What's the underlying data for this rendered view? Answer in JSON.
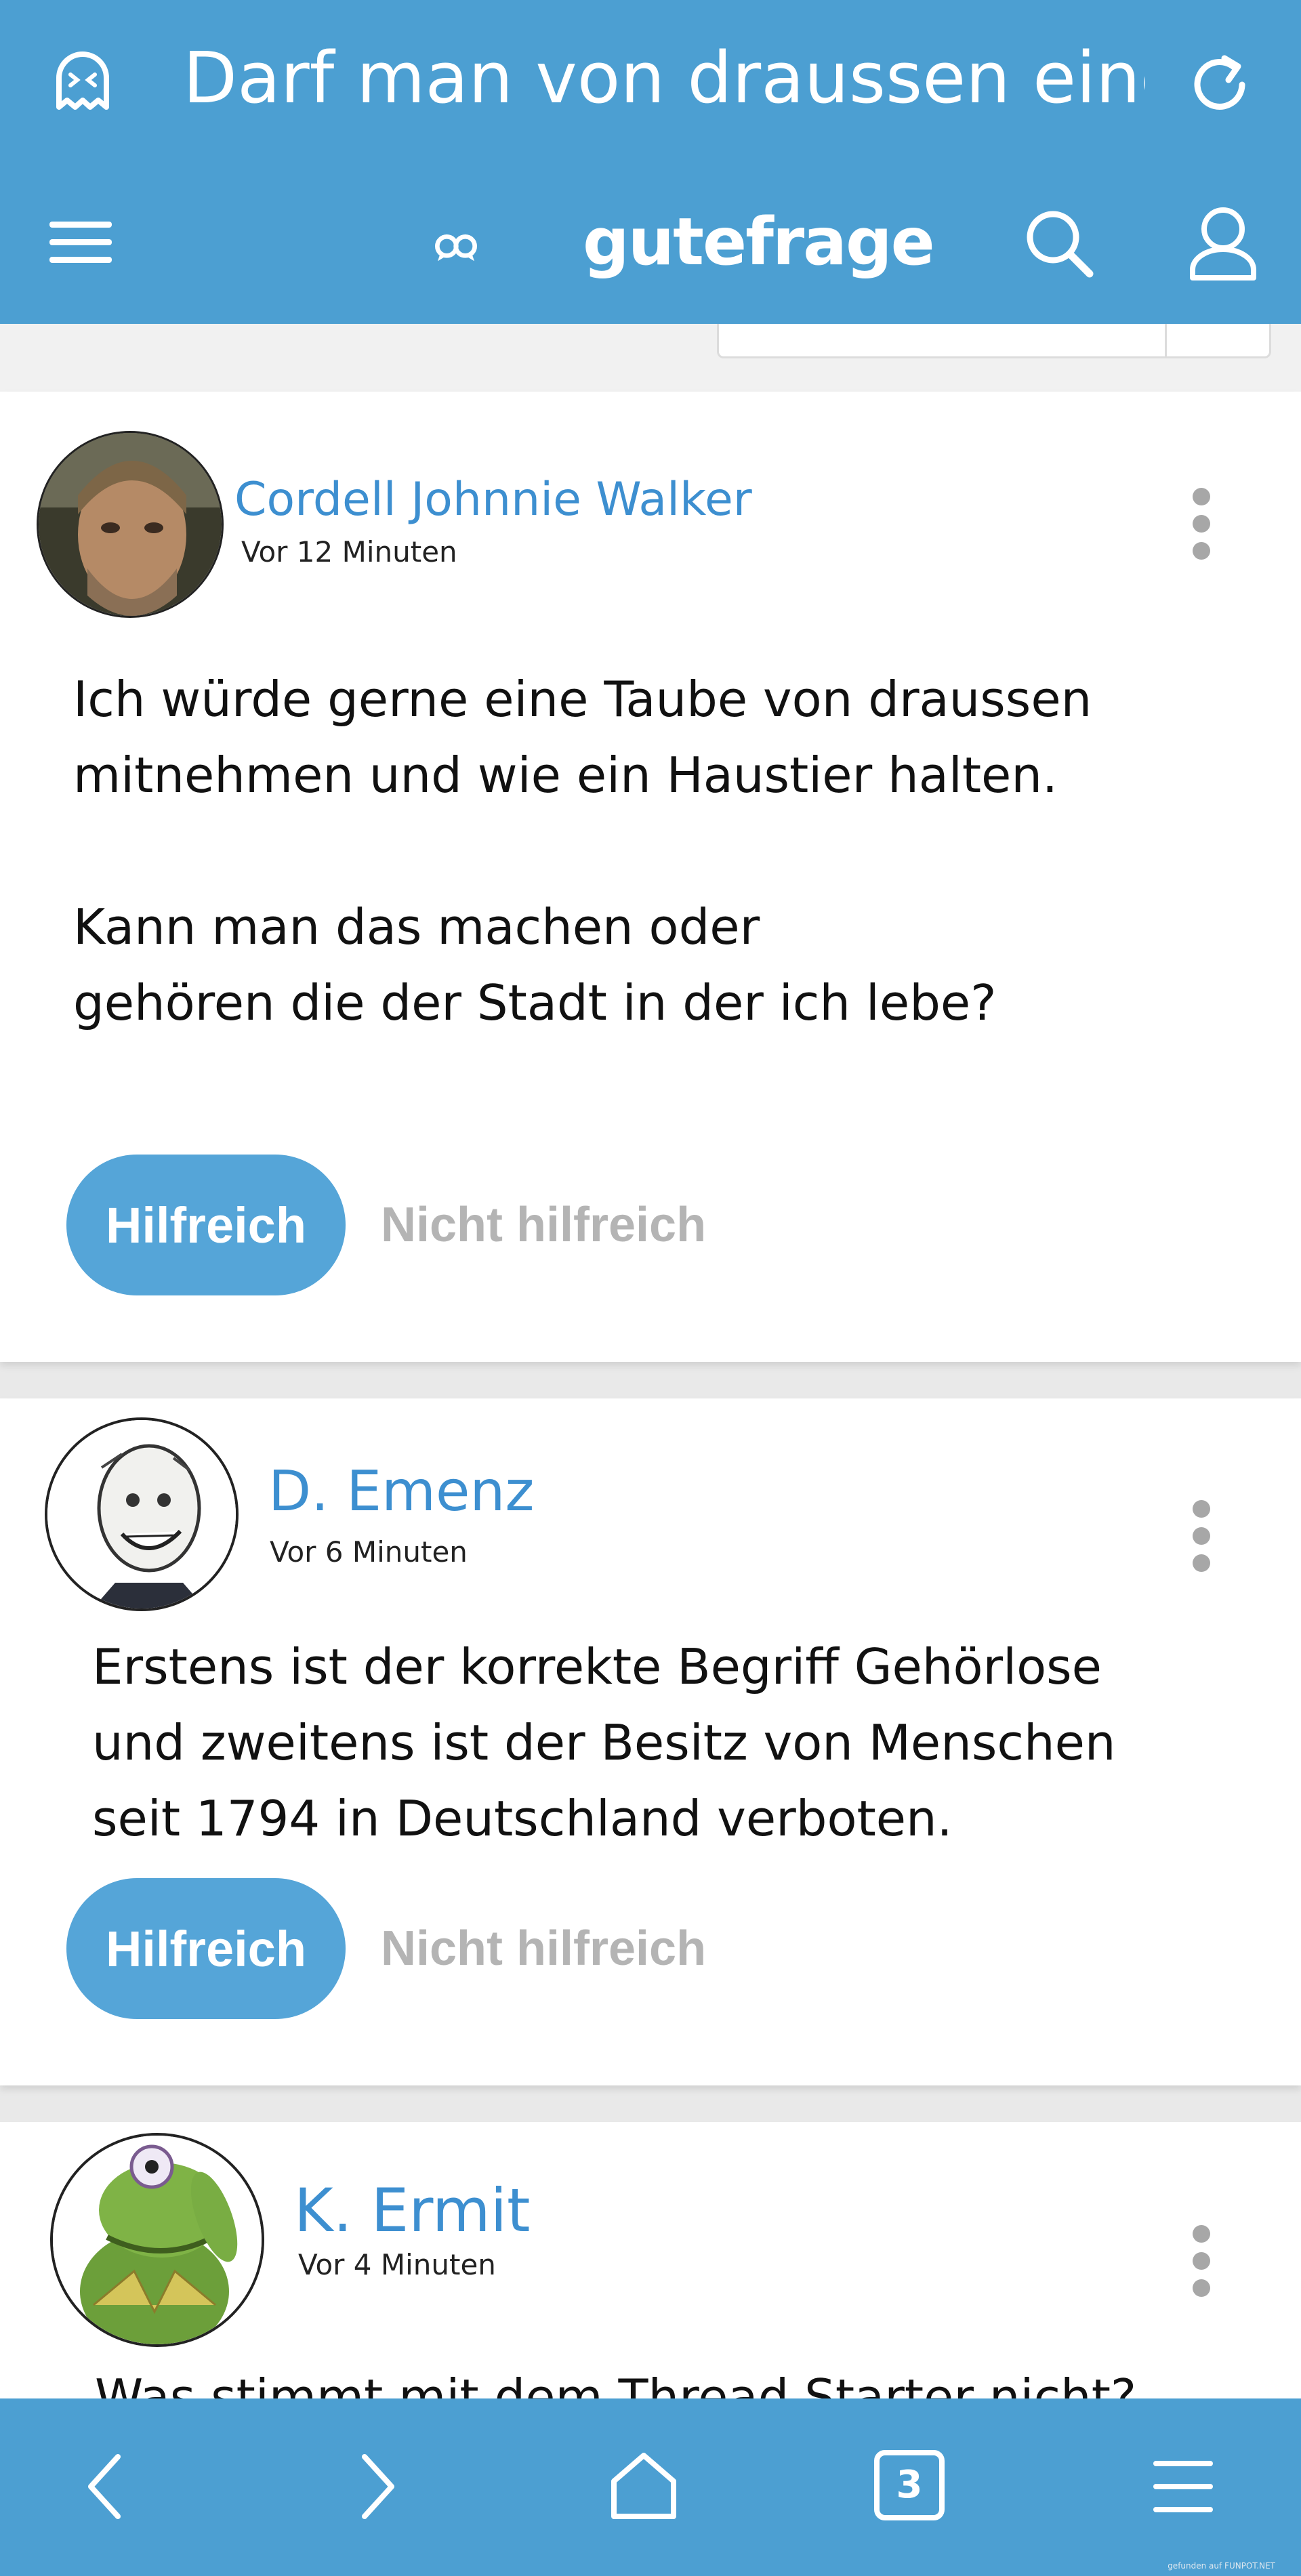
{
  "header": {
    "title": "Darf man von draussen eine",
    "logo_text": "gutefrage",
    "accent_color": "#4c9fd2",
    "icons": [
      "ghost-icon",
      "reload-icon",
      "menu-icon",
      "gutefrage-logo-icon",
      "search-icon",
      "user-icon"
    ]
  },
  "posts": [
    {
      "author": "Cordell Johnnie Walker",
      "time": "Vor 12 Minuten",
      "text": "Ich würde gerne eine Taube von draussen\nmitnehmen und wie ein Haustier halten.\n\nKann man das machen oder\ngehören die der Stadt in der ich lebe?",
      "helpful_label": "Hilfreich",
      "not_helpful_label": "Nicht hilfreich"
    },
    {
      "author": "D. Emenz",
      "time": "Vor 6 Minuten",
      "text": "Erstens ist der korrekte Begriff Gehörlose\nund zweitens ist der Besitz von Menschen\nseit 1794 in Deutschland verboten.",
      "helpful_label": "Hilfreich",
      "not_helpful_label": "Nicht hilfreich"
    },
    {
      "author": "K. Ermit",
      "time": "Vor 4 Minuten",
      "text": "Was stimmt mit dem Thread Starter nicht?"
    }
  ],
  "browser_nav": {
    "tab_count": "3",
    "icons": [
      "back-icon",
      "forward-icon",
      "home-icon",
      "tabs-icon",
      "browser-menu-icon"
    ]
  },
  "watermark": "gefunden auf  FUNPOT.NET"
}
